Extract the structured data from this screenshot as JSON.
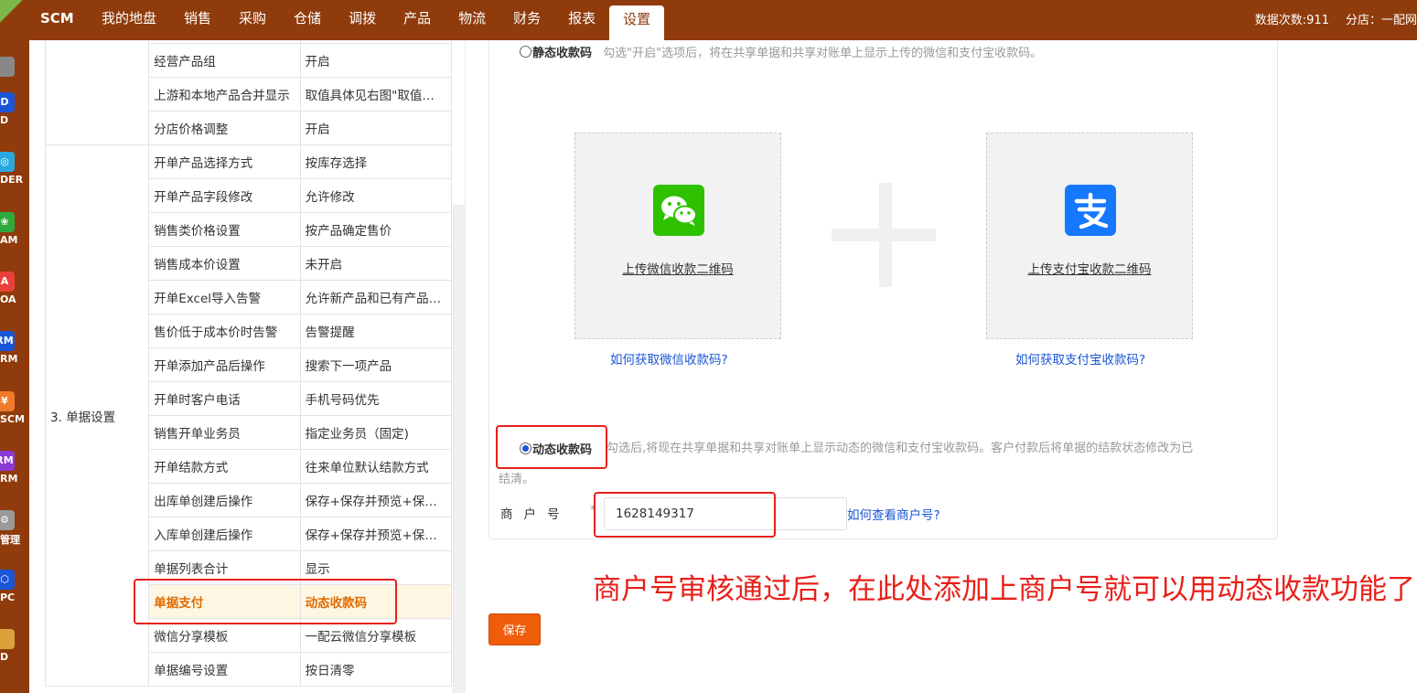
{
  "topnav": {
    "logo": "SCM",
    "items": [
      "我的地盘",
      "销售",
      "采购",
      "仓储",
      "调拨",
      "产品",
      "物流",
      "财务",
      "报表",
      "设置"
    ],
    "active_index": 9,
    "data_count": "数据次数:911",
    "branch": "分店：一配网"
  },
  "dock": {
    "items": [
      {
        "icon": "wrench-icon",
        "label": "",
        "color": "#888888"
      },
      {
        "icon": "d-app-icon",
        "letter": "D",
        "label": "D",
        "color": "#1a56d6"
      },
      {
        "icon": "globe-icon",
        "letter": "◎",
        "label": "DER",
        "color": "#29a8e0"
      },
      {
        "icon": "paw-icon",
        "letter": "❀",
        "label": "AM",
        "color": "#2eaa3c"
      },
      {
        "icon": "a-app-icon",
        "letter": "A",
        "label": "OA",
        "color": "#e8403a"
      },
      {
        "icon": "rm-app-icon",
        "letter": "RM",
        "label": "RM",
        "color": "#1a56d6"
      },
      {
        "icon": "yen-icon",
        "letter": "¥",
        "label": "SCM",
        "color": "#ef7a2a"
      },
      {
        "icon": "rm2-app-icon",
        "letter": "RM",
        "label": "RM",
        "color": "#8a3ad6"
      },
      {
        "icon": "gear-icon",
        "letter": "⚙",
        "label": "管理",
        "color": "#999999"
      },
      {
        "icon": "hexagon-icon",
        "letter": "⬡",
        "label": "PC",
        "color": "#1a56d6"
      },
      {
        "icon": "photo-icon",
        "letter": "",
        "label": "D",
        "color": "#d9a33a"
      }
    ]
  },
  "settings": {
    "group_label": "3. 单据设置",
    "rows": [
      {
        "key": "",
        "val": ""
      },
      {
        "key": "经营产品组",
        "val": "开启"
      },
      {
        "key": "上游和本地产品合并显示",
        "val": "取值具体见右图\"取值规则\""
      },
      {
        "key": "分店价格调整",
        "val": "开启"
      },
      {
        "key": "开单产品选择方式",
        "val": "按库存选择"
      },
      {
        "key": "开单产品字段修改",
        "val": "允许修改"
      },
      {
        "key": "销售类价格设置",
        "val": "按产品确定售价"
      },
      {
        "key": "销售成本价设置",
        "val": "未开启"
      },
      {
        "key": "开单Excel导入告警",
        "val": "允许新产品和已有产品导入"
      },
      {
        "key": "售价低于成本价时告警",
        "val": "告警提醒"
      },
      {
        "key": "开单添加产品后操作",
        "val": "搜索下一项产品"
      },
      {
        "key": "开单时客户电话",
        "val": "手机号码优先"
      },
      {
        "key": "销售开单业务员",
        "val": "指定业务员（固定)"
      },
      {
        "key": "开单结款方式",
        "val": "往来单位默认结款方式"
      },
      {
        "key": "出库单创建后操作",
        "val": "保存+保存并预览+保存并打印"
      },
      {
        "key": "入库单创建后操作",
        "val": "保存+保存并预览+保存并打印"
      },
      {
        "key": "单据列表合计",
        "val": "显示"
      },
      {
        "key": "单据支付",
        "val": "动态收款码"
      },
      {
        "key": "微信分享模板",
        "val": "一配云微信分享模板"
      },
      {
        "key": "单据编号设置",
        "val": "按日清零"
      }
    ],
    "highlight_index": 17
  },
  "payment": {
    "static_label": "静态收款码",
    "static_hint": "勾选\"开启\"选项后，将在共享单据和共享对账单上显示上传的微信和支付宝收款码。",
    "wechat_upload": "上传微信收款二维码",
    "wechat_help": "如何获取微信收款码?",
    "alipay_upload": "上传支付宝收款二维码",
    "alipay_help": "如何获取支付宝收款码?",
    "dynamic_label": "动态收款码",
    "dynamic_hint_1": "勾选后,将现在共享单据和共享对账单上显示动态的微信和支付宝收款码。客户付款后将单据的结款状态修改为已",
    "dynamic_hint_2": "结清。",
    "merchant_label": "商户号",
    "merchant_star": "*",
    "merchant_value": "1628149317",
    "merchant_help": "如何查看商户号?",
    "selected": "dynamic"
  },
  "actions": {
    "save_label": "保存"
  },
  "annotation": {
    "text": "商户号审核通过后，在此处添加上商户号就可以用动态收款功能了"
  },
  "colors": {
    "brand": "#8f3b0c",
    "accent": "#ef5c0a",
    "link": "#1a56d6",
    "annotation": "#e8201a",
    "wechat": "#2dc100",
    "alipay": "#1677ff"
  }
}
